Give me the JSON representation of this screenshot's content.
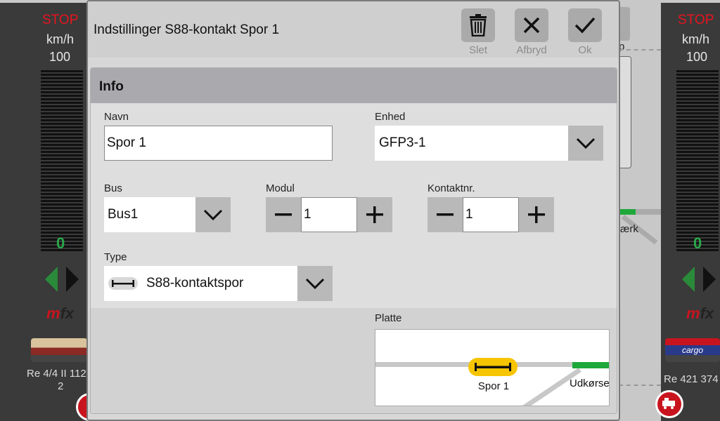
{
  "left_panel": {
    "stop": "STOP",
    "unit": "km/h",
    "max_speed": "100",
    "current_speed": "0",
    "loco_name": "Re 4/4 II 112",
    "loco_num": "2"
  },
  "right_panel": {
    "stop": "STOP",
    "unit": "km/h",
    "max_speed": "100",
    "current_speed": "0",
    "loco_name": "Re 421 374",
    "loco_label": "cargo"
  },
  "background": {
    "partial_label_p": "p",
    "partial_label_aerk": "ærk"
  },
  "dialog": {
    "title": "Indstillinger S88-kontakt Spor 1",
    "buttons": {
      "delete": "Slet",
      "cancel": "Afbryd",
      "ok": "Ok"
    },
    "section_title": "Info",
    "fields": {
      "name_label": "Navn",
      "name_value": "Spor 1",
      "device_label": "Enhed",
      "device_value": "GFP3-1",
      "bus_label": "Bus",
      "bus_value": "Bus1",
      "module_label": "Modul",
      "module_value": "1",
      "contact_label": "Kontaktnr.",
      "contact_value": "1",
      "type_label": "Type",
      "type_value": "S88-kontaktspor"
    },
    "preview": {
      "label": "Platte",
      "contact_name": "Spor 1",
      "exit_name": "Udkørse"
    }
  },
  "colors": {
    "stop_red": "#e8141e",
    "speed_green": "#2aa84a",
    "contact_yellow": "#f6c400",
    "track_green": "#1fa83a"
  }
}
